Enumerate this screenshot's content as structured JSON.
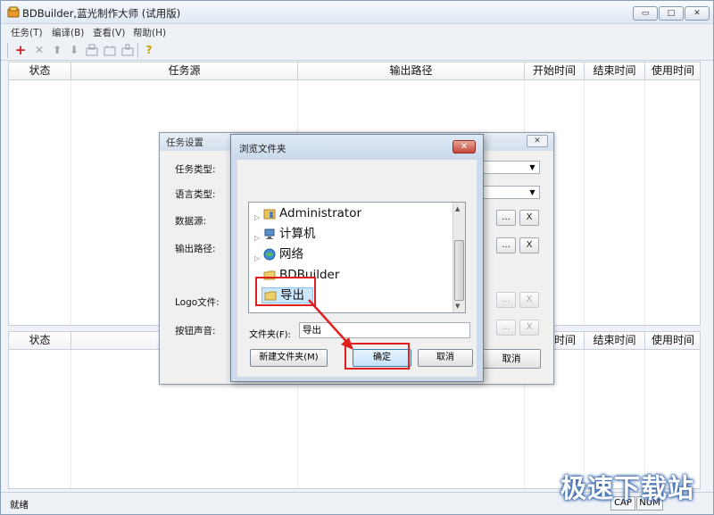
{
  "window": {
    "title": "BDBuilder,蓝光制作大师 (试用版)",
    "controls": {
      "minimize": "▭",
      "maximize": "□",
      "close": "✕"
    }
  },
  "menu": [
    "任务(T)",
    "编译(B)",
    "查看(V)",
    "帮助(H)"
  ],
  "toolbar": {
    "icons": [
      "add-icon",
      "delete-icon",
      "move-up-icon",
      "move-down-icon",
      "tool-a-icon",
      "tool-b-icon",
      "tool-c-icon",
      "help-icon"
    ],
    "add": "+",
    "delete": "✕",
    "up": "⬆",
    "down": "⬇",
    "help": "?"
  },
  "task_table": {
    "columns": [
      "状态",
      "任务源",
      "输出路径",
      "开始时间",
      "结束时间",
      "使用时间"
    ]
  },
  "log_table": {
    "columns": [
      "状态",
      "",
      "",
      "开始时间",
      "结束时间",
      "使用时间"
    ]
  },
  "status_bar": {
    "text": "就绪",
    "cap": "CAP",
    "num": "NUM"
  },
  "task_dialog": {
    "title": "任务设置",
    "close": "✕",
    "labels": {
      "task_type": "任务类型:",
      "language_type": "语言类型:",
      "data_source": "数据源:",
      "output_path": "输出路径:",
      "logo_file": "Logo文件:",
      "button_sound": "按钮声音:"
    },
    "browse": "...",
    "clear": "X",
    "cancel": "取消"
  },
  "browse_dialog": {
    "title": "浏览文件夹",
    "close": "✕",
    "tree": [
      {
        "label": "Administrator",
        "icon": "user-folder-icon",
        "expandable": true
      },
      {
        "label": "计算机",
        "icon": "computer-icon",
        "expandable": true
      },
      {
        "label": "网络",
        "icon": "network-icon",
        "expandable": true
      },
      {
        "label": "BDBuilder",
        "icon": "folder-icon",
        "expandable": false
      },
      {
        "label": "导出",
        "icon": "folder-icon",
        "expandable": false,
        "selected": true
      }
    ],
    "folder_label": "文件夹(F):",
    "folder_value": "导出",
    "new_folder": "新建文件夹(M)",
    "ok": "确定",
    "cancel": "取消"
  },
  "colors": {
    "highlight": "#e02020",
    "selection": "#cce8ff"
  },
  "watermark": "极速下载站"
}
